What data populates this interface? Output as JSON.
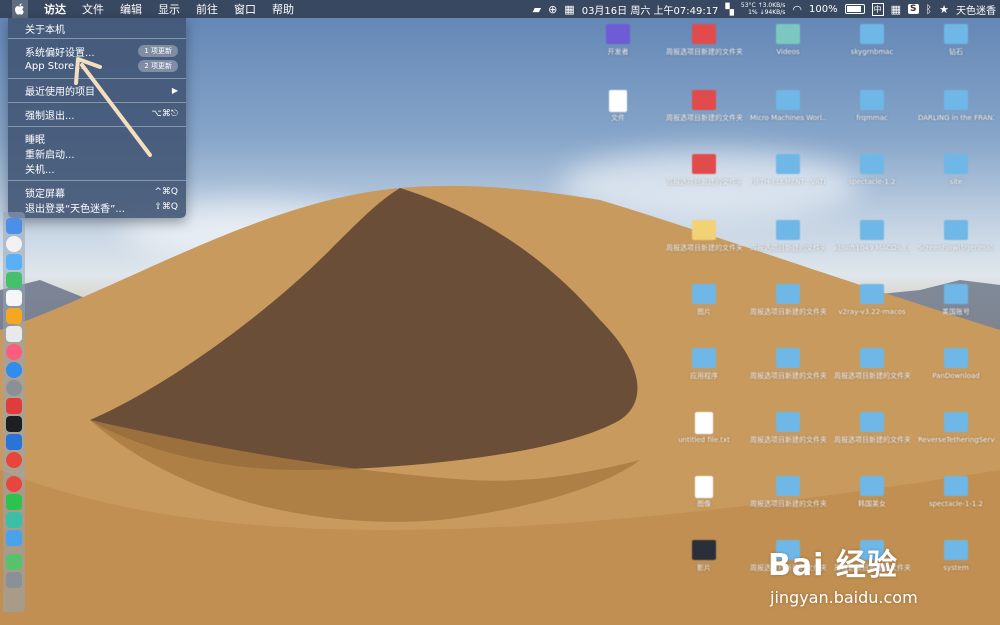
{
  "menubar": {
    "apple_icon": "apple-icon",
    "items": [
      "访达",
      "文件",
      "编辑",
      "显示",
      "前往",
      "窗口",
      "帮助"
    ],
    "status": {
      "temp": "53°C",
      "net_up": "↑3.0KB/s",
      "cpu": "1%",
      "net_down": "↓94KB/s",
      "datetime": "03月16日 周六 上午07:49:17",
      "battery": "100%",
      "input_method": "中",
      "user": "天色迷香"
    }
  },
  "apple_menu": {
    "about": "关于本机",
    "system_prefs": "系统偏好设置...",
    "system_prefs_badge": "1 项更新",
    "app_store": "App Store...",
    "app_store_badge": "2 项更新",
    "recent_items": "最近使用的项目",
    "force_quit": "强制退出...",
    "force_quit_shortcut": "⌥⌘⎋",
    "sleep": "睡眠",
    "restart": "重新启动...",
    "shutdown": "关机...",
    "lock_screen": "锁定屏幕",
    "lock_shortcut": "^⌘Q",
    "logout": "退出登录“天色迷香”...",
    "logout_shortcut": "⇧⌘Q"
  },
  "desktop": [
    {
      "label": "开发者",
      "kind": "purple"
    },
    {
      "label": "周报选项目新建的文件夹 4",
      "kind": "red"
    },
    {
      "label": "Videos",
      "kind": "teal"
    },
    {
      "label": "skygrnbmac",
      "kind": "folder"
    },
    {
      "label": "钻石",
      "kind": "folder"
    },
    {
      "label": "文件",
      "kind": "file"
    },
    {
      "label": "周报选项目新建的文件夹 5",
      "kind": "red"
    },
    {
      "label": "Micro Machines Worl...VATED",
      "kind": "folder"
    },
    {
      "label": "frqmmac",
      "kind": "folder"
    },
    {
      "label": "DARLING in the FRANXX",
      "kind": "folder"
    },
    {
      "label": "周报选项目新建的文件夹 6",
      "kind": "red"
    },
    {
      "label": "FIFTH-ELEMENT...VATED",
      "kind": "folder"
    },
    {
      "label": "spectacle-1.2",
      "kind": "folder"
    },
    {
      "label": "site",
      "kind": "folder"
    },
    {
      "label": "周报选项目新建的文件夹 2",
      "kind": "yellow"
    },
    {
      "label": "周报选项目新建的文件夹 10",
      "kind": "folder"
    },
    {
      "label": "kbsoft1049 MACOS...ECOO",
      "kind": "folder"
    },
    {
      "label": "ScreenFlow(f/gerima)...master",
      "kind": "folder"
    },
    {
      "label": "图片",
      "kind": "folder"
    },
    {
      "label": "周报选项目新建的文件夹 9",
      "kind": "folder"
    },
    {
      "label": "v2ray-v3.22-macos",
      "kind": "folder"
    },
    {
      "label": "美国账号",
      "kind": "folder"
    },
    {
      "label": "应用程序",
      "kind": "folder"
    },
    {
      "label": "周报选项目新建的文件夹 11",
      "kind": "folder"
    },
    {
      "label": "周报选项目新建的文件夹 13",
      "kind": "folder"
    },
    {
      "label": "PanDownload",
      "kind": "folder"
    },
    {
      "label": "untitled file.txt",
      "kind": "file"
    },
    {
      "label": "周报选项目新建的文件夹 7",
      "kind": "folder"
    },
    {
      "label": "周报选项目新建的文件夹 12",
      "kind": "folder"
    },
    {
      "label": "ReverseTetheringServer_1.2.0",
      "kind": "folder"
    },
    {
      "label": "图像",
      "kind": "file"
    },
    {
      "label": "周报选项目新建的文件夹 3",
      "kind": "folder"
    },
    {
      "label": "韩国美女",
      "kind": "folder"
    },
    {
      "label": "spectacle-1-1.2",
      "kind": "folder"
    },
    {
      "label": "影片",
      "kind": "dark"
    },
    {
      "label": "周报选项目新建的文件夹 8",
      "kind": "folder"
    },
    {
      "label": "周报选项目新建的文件夹 14",
      "kind": "folder"
    },
    {
      "label": "system",
      "kind": "folder"
    }
  ],
  "watermark": {
    "brand": "Bai 经验",
    "url": "jingyan.baidu.com"
  }
}
